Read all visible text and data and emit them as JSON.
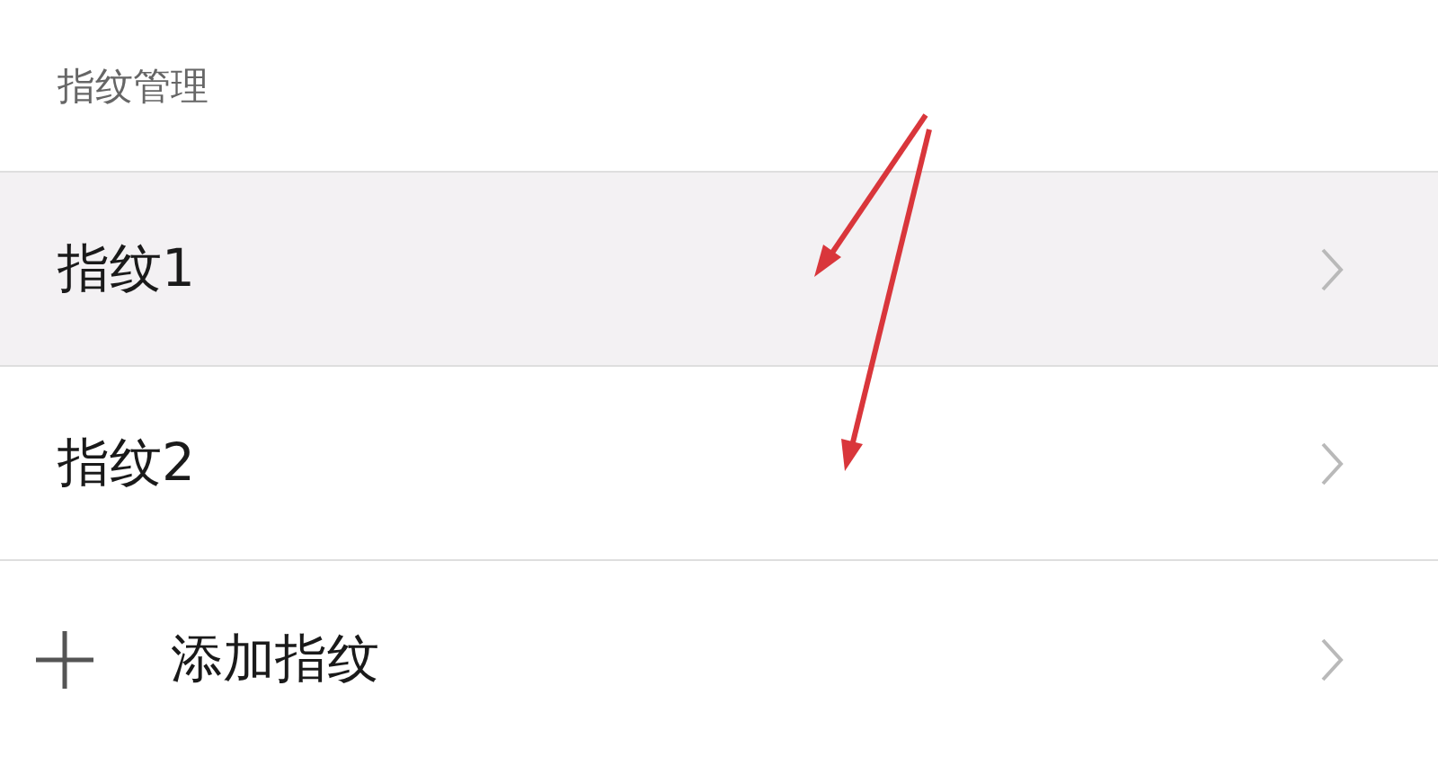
{
  "section_title": "指纹管理",
  "items": [
    {
      "kind": "fingerprint",
      "label": "指纹1",
      "selected": true
    },
    {
      "kind": "fingerprint",
      "label": "指纹2",
      "selected": false
    },
    {
      "kind": "add",
      "label": "添加指纹",
      "selected": false
    }
  ]
}
